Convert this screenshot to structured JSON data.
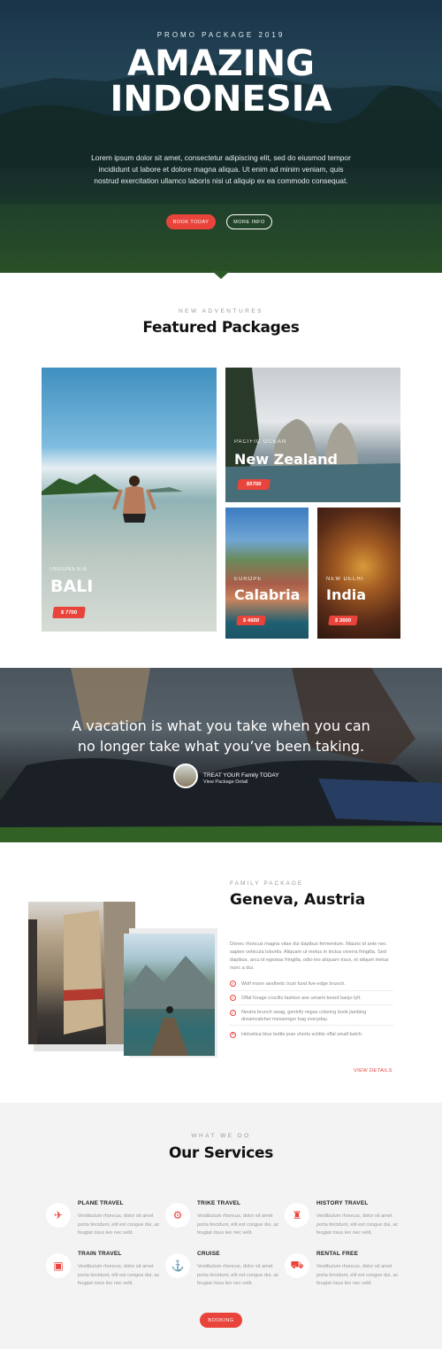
{
  "hero": {
    "kicker": "PROMO PACKAGE 2019",
    "title_line1": "AMAZING",
    "title_line2": "INDONESIA",
    "text": "Lorem ipsum dolor sit amet, consectetur adipiscing elit, sed do eiusmod tempor incididunt ut labore et dolore magna aliqua. Ut enim ad minim veniam, quis nostrud exercitation ullamco laboris nisi ut aliquip ex ea commodo consequat.",
    "book_label": "BOOK TODAY",
    "more_label": "MORE INFO"
  },
  "featured": {
    "kicker": "NEW ADVENTURES",
    "title": "Featured Packages",
    "cards": [
      {
        "tag": "INDONESIA",
        "name": "BALI",
        "price": "$ 7700"
      },
      {
        "tag": "PACIFIC OCEAN",
        "name": "New Zealand",
        "price": "$5700"
      },
      {
        "tag": "EUROPE",
        "name": "Calabria",
        "price": "$ 4600"
      },
      {
        "tag": "NEW DELHI",
        "name": "India",
        "price": "$ 3600"
      }
    ]
  },
  "quote": {
    "line1": "A vacation is what you take when you can",
    "line2": "no longer take what you’ve been taking.",
    "name": "TREAT YOUR Family TODAY",
    "sub": "View Package Detail"
  },
  "family": {
    "kicker": "FAMILY PACKAGE",
    "title": "Geneva, Austria",
    "desc": "Donec rhoncus magna vitae dui dapibus fermentum. Mauris id ante nec sapien vehicula lobortis. Aliquam ut metus in lectus viverra fringilla. Sed dapibus, arcu id egestas fringilla, odio leo aliquam risus, et aliquet metus nunc a dui.",
    "items": [
      "Wolf moon aesthetic trust fund live-edge brunch.",
      "Offal forage crucifix fashion axe umami beard banjo lyft.",
      "Neutra brunch swag, gentrify migas coloring book jianbing dreamcatcher messenger bag everyday.",
      "Helvetica blue bottle jean shorts schlitz offal small batch."
    ],
    "item_marks": [
      "✓",
      "✓",
      "✓",
      "✕"
    ],
    "view_details": "VIEW DETAILS"
  },
  "services": {
    "kicker": "WHAT WE DO",
    "title": "Our Services",
    "items": [
      {
        "title": "PLANE TRAVEL",
        "icon": "plane-icon",
        "glyph": "✈",
        "desc": "Vestibulum rhoncus, dolor sit amet porta tincidunt, elit est congue dui, ac feugiat risus leo nec velit."
      },
      {
        "title": "TRIKE TRAVEL",
        "icon": "motorcycle-icon",
        "glyph": "⚙",
        "desc": "Vestibulum rhoncus, dolor sit amet porta tincidunt, elit est congue dui, ac feugiat risus leo nec velit."
      },
      {
        "title": "HISTORY TRAVEL",
        "icon": "castle-icon",
        "glyph": "♜",
        "desc": "Vestibulum rhoncus, dolor sit amet porta tincidunt, elit est congue dui, ac feugiat risus leo nec velit."
      },
      {
        "title": "TRAIN TRAVEL",
        "icon": "train-icon",
        "glyph": "▣",
        "desc": "Vestibulum rhoncus, dolor sit amet porta tincidunt, elit est congue dui, ac feugiat risus leo nec velit."
      },
      {
        "title": "CRUISE",
        "icon": "ship-icon",
        "glyph": "⚓",
        "desc": "Vestibulum rhoncus, dolor sit amet porta tincidunt, elit est congue dui, ac feugiat risus leo nec velit."
      },
      {
        "title": "RENTAL FREE",
        "icon": "car-icon",
        "glyph": "⛟",
        "desc": "Vestibulum rhoncus, dolor sit amet porta tincidunt, elit est congue dui, ac feugiat risus leo nec velit."
      }
    ],
    "button_label": "BOOKING"
  },
  "colors": {
    "accent": "#e9443b",
    "services_bg": "#f3f3f3"
  }
}
